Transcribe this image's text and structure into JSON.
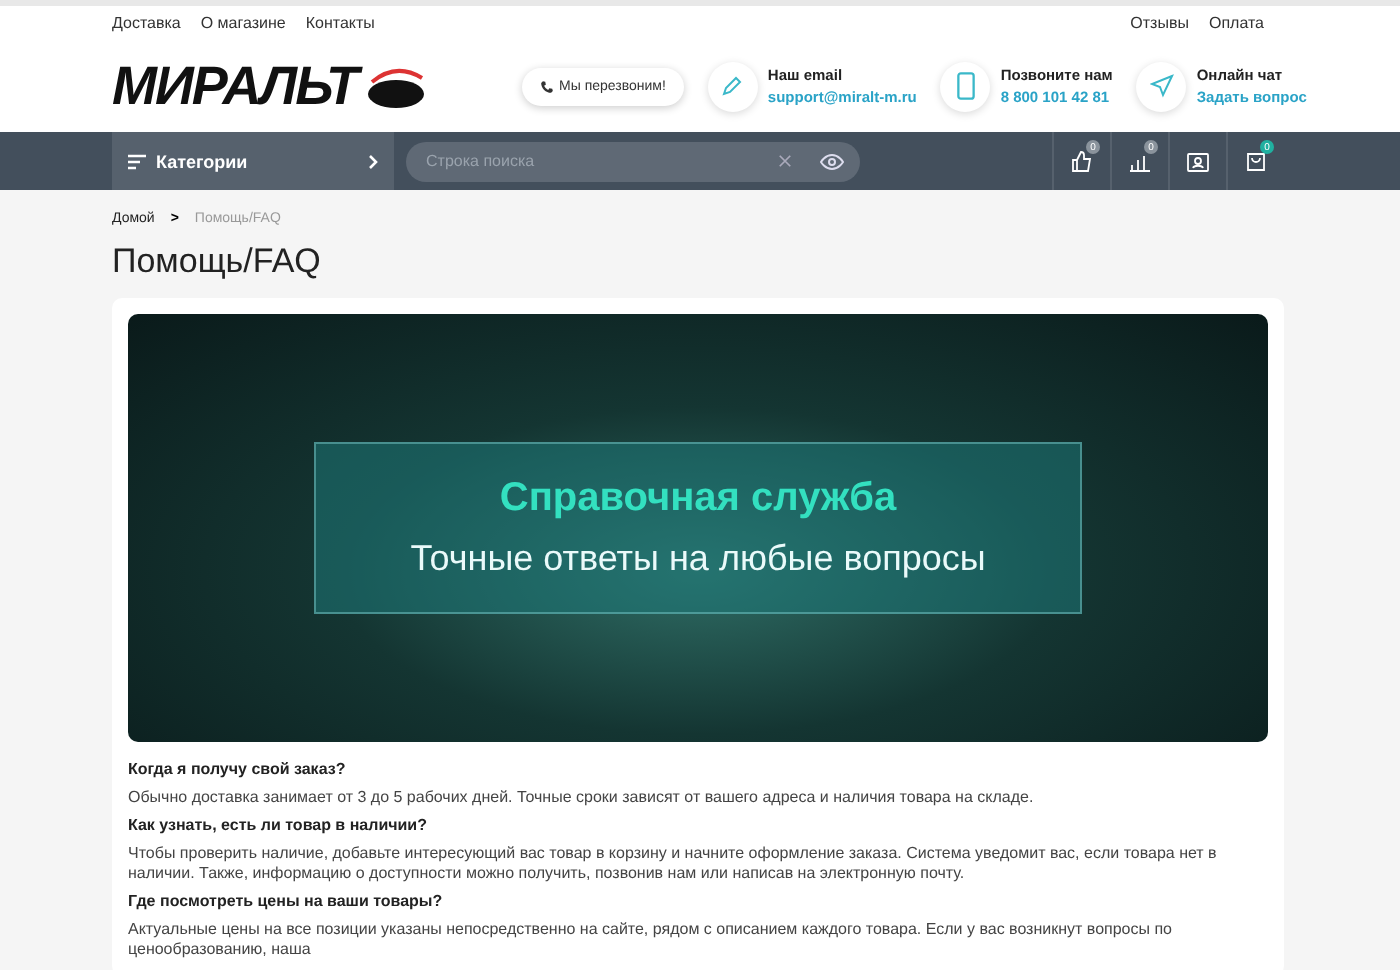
{
  "top_links_left": [
    "Доставка",
    "О магазине",
    "Контакты"
  ],
  "top_links_right": [
    "Отзывы",
    "Оплата"
  ],
  "logo": {
    "text": "МИРАЛЬТ"
  },
  "callback_button": {
    "label": "Мы перезвоним!"
  },
  "contacts": [
    {
      "kind": "email",
      "title": "Наш email",
      "value": "support@miralt-m.ru"
    },
    {
      "kind": "phone",
      "title": "Позвоните нам",
      "value": "8 800 101 42 81"
    },
    {
      "kind": "chat",
      "title": "Онлайн чат",
      "value": "Задать вопрос"
    }
  ],
  "nav": {
    "categories": "Категории",
    "search": {
      "placeholder": "Строка поиска"
    },
    "actions": [
      {
        "kind": "like",
        "badge": "0"
      },
      {
        "kind": "compare",
        "badge": "0"
      },
      {
        "kind": "profile"
      },
      {
        "kind": "cart",
        "badge": "0"
      }
    ]
  },
  "breadcrumb_separator": ">",
  "breadcrumbs": [
    {
      "label": "Домой",
      "current": false
    },
    {
      "label": "Помощь/FAQ",
      "current": true
    }
  ],
  "page_title": "Помощь/FAQ",
  "banner": {
    "title": "Справочная служба",
    "subtitle": "Точные ответы на любые вопросы"
  },
  "faq": [
    {
      "question": "Когда я получу свой заказ?",
      "answer": "Обычно доставка занимает от 3 до 5 рабочих дней. Точные сроки зависят от вашего адреса и наличия товара на складе."
    },
    {
      "question": "Как узнать, есть ли товар в наличии?",
      "answer": "Чтобы проверить наличие, добавьте интересующий вас товар в корзину и начните оформление заказа. Система уведомит вас, если товара нет в наличии. Также, информацию о доступности можно получить, позвонив нам или написав на электронную почту."
    },
    {
      "question": "Где посмотреть цены на ваши товары?",
      "answer": "Актуальные цены на все позиции указаны непосредственно на сайте, рядом с описанием каждого товара. Если у вас возникнут вопросы по ценообразованию, наша"
    }
  ]
}
